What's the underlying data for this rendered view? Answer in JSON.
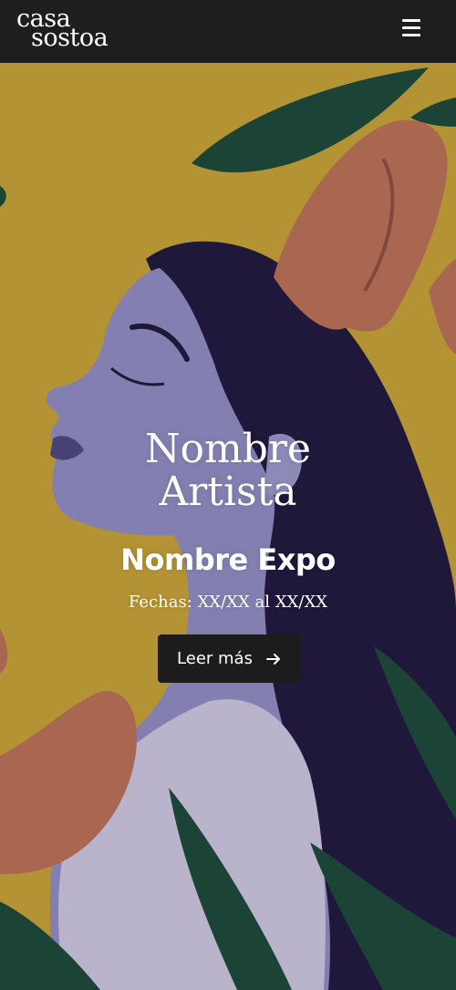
{
  "header": {
    "logo_line1": "casa",
    "logo_line2": "sostoa",
    "menu_icon": "hamburger-menu-icon"
  },
  "hero": {
    "artist_line1": "Nombre",
    "artist_line2": "Artista",
    "expo_name": "Nombre Expo",
    "dates": "Fechas: XX/XX al XX/XX",
    "cta_label": "Leer más",
    "cta_icon": "arrow-right-icon"
  },
  "colors": {
    "header_bg": "#1e1e1e",
    "background_ochre": "#c9a43d",
    "hair": "#231b3f",
    "skin": "#8f8bc1",
    "leaf": "#1e4a3c",
    "flower": "#b8705a",
    "button_bg": "#1c1c1c"
  }
}
